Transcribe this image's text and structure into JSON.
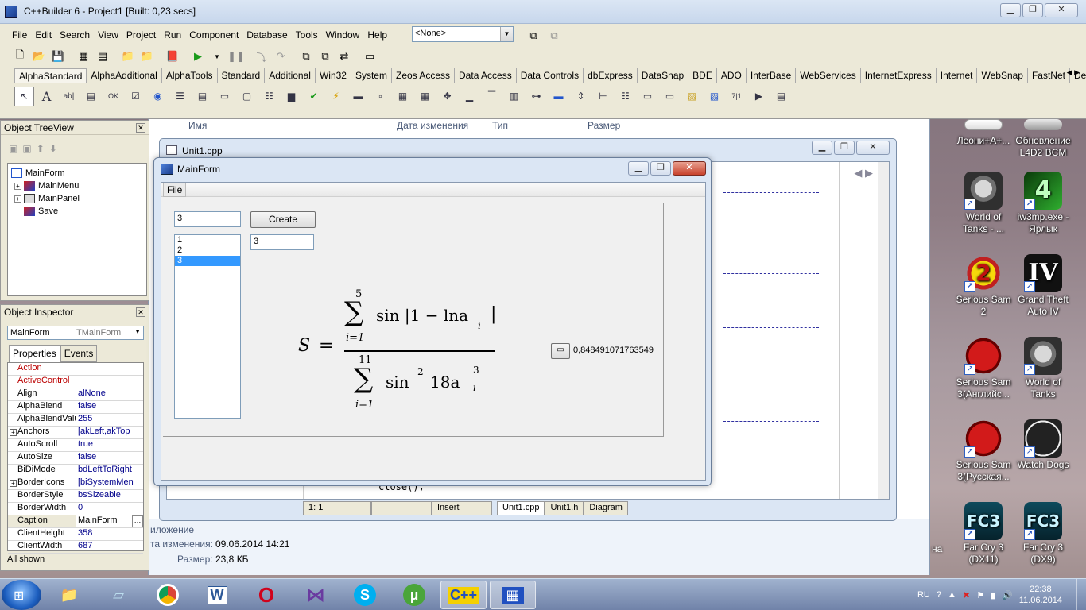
{
  "cbuilder": {
    "title": "C++Builder 6 - Project1 [Built: 0,23 secs]",
    "menu": [
      "File",
      "Edit",
      "Search",
      "View",
      "Project",
      "Run",
      "Component",
      "Database",
      "Tools",
      "Window",
      "Help"
    ],
    "config_combo": "<None>",
    "palette_tabs": [
      "AlphaStandard",
      "AlphaAdditional",
      "AlphaTools",
      "Standard",
      "Additional",
      "Win32",
      "System",
      "Zeos Access",
      "Data Access",
      "Data Controls",
      "dbExpress",
      "DataSnap",
      "BDE",
      "ADO",
      "InterBase",
      "WebServices",
      "InternetExpress",
      "Internet",
      "WebSnap",
      "FastNet",
      "Decision Cub"
    ]
  },
  "tree_view": {
    "title": "Object TreeView",
    "items": [
      "MainForm",
      "MainMenu",
      "MainPanel",
      "Save"
    ]
  },
  "inspector": {
    "title": "Object Inspector",
    "selected_object": "MainForm",
    "selected_type": "TMainForm",
    "tabs": [
      "Properties",
      "Events"
    ],
    "rows": [
      {
        "k": "Action",
        "v": ""
      },
      {
        "k": "ActiveControl",
        "v": ""
      },
      {
        "k": "Align",
        "v": "alNone"
      },
      {
        "k": "AlphaBlend",
        "v": "false"
      },
      {
        "k": "AlphaBlendValu",
        "v": "255"
      },
      {
        "k": "Anchors",
        "v": "[akLeft,akTop"
      },
      {
        "k": "AutoScroll",
        "v": "true"
      },
      {
        "k": "AutoSize",
        "v": "false"
      },
      {
        "k": "BiDiMode",
        "v": "bdLeftToRight"
      },
      {
        "k": "BorderIcons",
        "v": "[biSystemMen"
      },
      {
        "k": "BorderStyle",
        "v": "bsSizeable"
      },
      {
        "k": "BorderWidth",
        "v": "0"
      },
      {
        "k": "Caption",
        "v": "MainForm"
      },
      {
        "k": "ClientHeight",
        "v": "358"
      },
      {
        "k": "ClientWidth",
        "v": "687"
      }
    ],
    "footer": "All shown"
  },
  "explorer": {
    "columns": [
      "Имя",
      "Дата изменения",
      "Тип",
      "Размер"
    ],
    "details": {
      "type_partial": "иложение",
      "modified_label": "та изменения:",
      "modified_value": "09.06.2014 14:21",
      "size_label": "Размер:",
      "size_value": "23,8 КБ"
    }
  },
  "code_window": {
    "title": "Unit1.cpp",
    "code_fragment": "close();",
    "status_pos": "1:   1",
    "status_mode": "Insert",
    "tabs": [
      "Unit1.cpp",
      "Unit1.h",
      "Diagram"
    ]
  },
  "main_form": {
    "title": "MainForm",
    "menu": [
      "File"
    ],
    "edit_n": "3",
    "create_label": "Create",
    "list_items": [
      "1",
      "2",
      "3"
    ],
    "selected_index": 2,
    "edit_value": "3",
    "result": "0,848491071763549",
    "formula": {
      "lhs": "S",
      "eq": "=",
      "num_upper": "5",
      "num_lower": "i=1",
      "num_body": "sin |1 − lna",
      "num_sub": "i",
      "den_upper": "11",
      "den_lower": "i=1",
      "den_body_a": "sin",
      "den_pow": "2",
      "den_body_b": "18a",
      "den_sup": "3",
      "den_sub": "i"
    }
  },
  "desktop_icons": [
    {
      "label": "Леони+А+...",
      "icon": "pdf-icon"
    },
    {
      "label": "Обновление L4D2 BCM",
      "icon": "update-icon"
    },
    {
      "label": "World of Tanks - ...",
      "icon": "world-of-tanks-icon"
    },
    {
      "label": "iw3mp.exe - Ярлык",
      "icon": "cod4-icon"
    },
    {
      "label": "Serious Sam 2",
      "icon": "serious-sam-2-icon"
    },
    {
      "label": "Grand Theft Auto IV",
      "icon": "gta-iv-icon"
    },
    {
      "label": "Serious Sam 3(Английс...",
      "icon": "serious-sam-3-icon"
    },
    {
      "label": "World of Tanks",
      "icon": "world-of-tanks-icon"
    },
    {
      "label": "Serious Sam 3(Русская...",
      "icon": "serious-sam-3-icon"
    },
    {
      "label": "Watch Dogs",
      "icon": "watch-dogs-icon"
    },
    {
      "label": "Far Cry 3 (DX11)",
      "icon": "far-cry-3-icon"
    },
    {
      "label": "Far Cry 3 (DX9)",
      "icon": "far-cry-3-icon"
    }
  ],
  "taskbar": {
    "lang": "RU",
    "time": "22:38",
    "date": "11.06.2014",
    "partial_label": "на"
  }
}
